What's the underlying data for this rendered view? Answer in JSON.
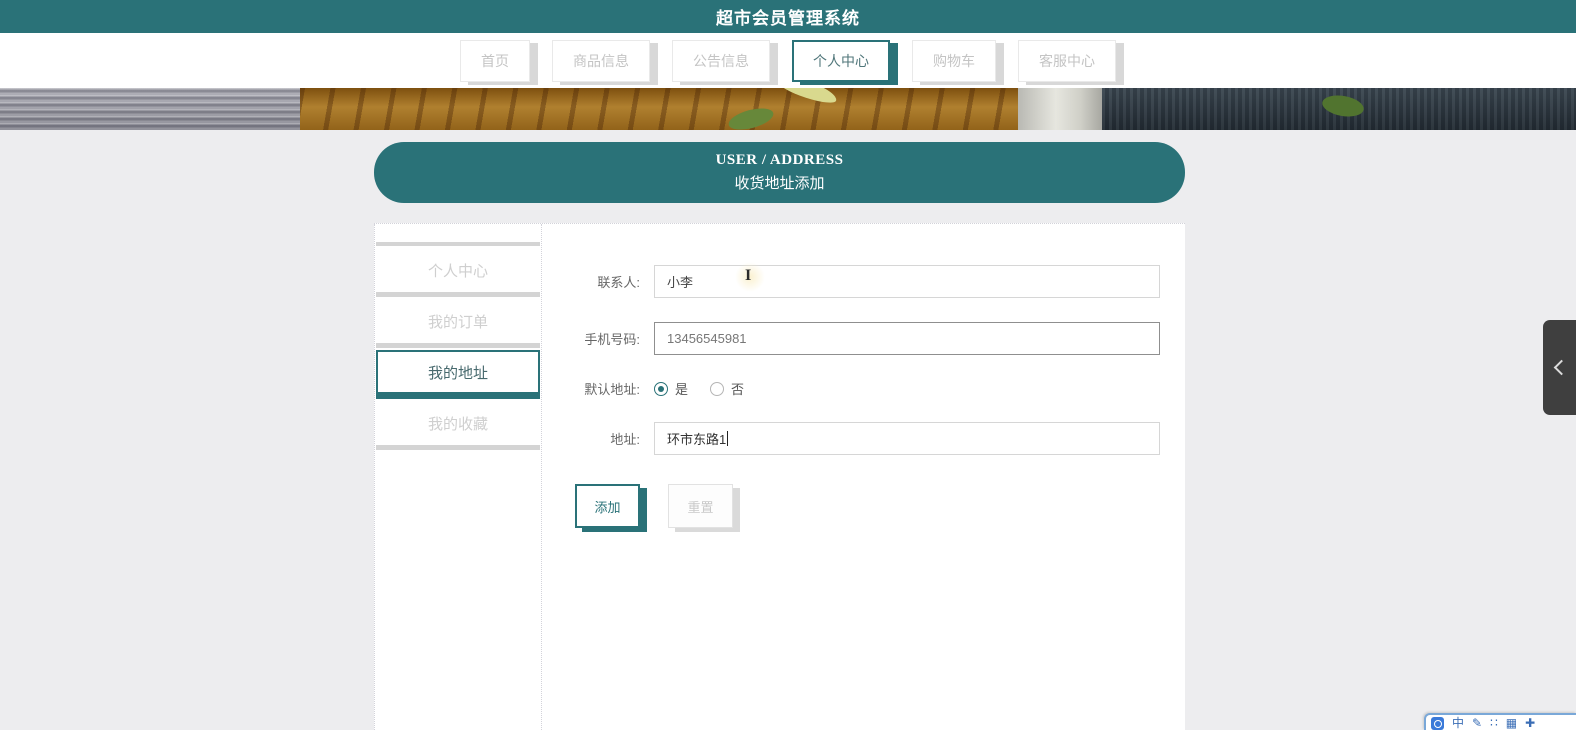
{
  "app": {
    "title": "超市会员管理系统"
  },
  "nav": {
    "tabs": [
      {
        "label": "首页",
        "active": false
      },
      {
        "label": "商品信息",
        "active": false
      },
      {
        "label": "公告信息",
        "active": false
      },
      {
        "label": "个人中心",
        "active": true
      },
      {
        "label": "购物车",
        "active": false
      },
      {
        "label": "客服中心",
        "active": false
      }
    ]
  },
  "banner": {
    "line1": "USER / ADDRESS",
    "line2": "收货地址添加"
  },
  "sidebar": {
    "items": [
      {
        "label": "个人中心",
        "active": false
      },
      {
        "label": "我的订单",
        "active": false
      },
      {
        "label": "我的地址",
        "active": true
      },
      {
        "label": "我的收藏",
        "active": false
      }
    ]
  },
  "form": {
    "contact": {
      "label": "联系人:",
      "value": "小李"
    },
    "phone": {
      "label": "手机号码:",
      "value": "13456545981"
    },
    "default_address": {
      "label": "默认地址:",
      "yes_label": "是",
      "no_label": "否",
      "selected": "是"
    },
    "address": {
      "label": "地址:",
      "value": "环市东路1"
    },
    "add_button": "添加",
    "reset_button": "重置"
  },
  "side_panel": {
    "icon": "chevron-left-icon"
  },
  "ime_bar": {
    "mode": "中"
  },
  "colors": {
    "accent": "#2a7278",
    "tab_shadow": "#d8d8d8",
    "dark_panel": "#3f3f3f",
    "ime_blue": "#3a7ad9",
    "page_bg": "#ededef"
  }
}
